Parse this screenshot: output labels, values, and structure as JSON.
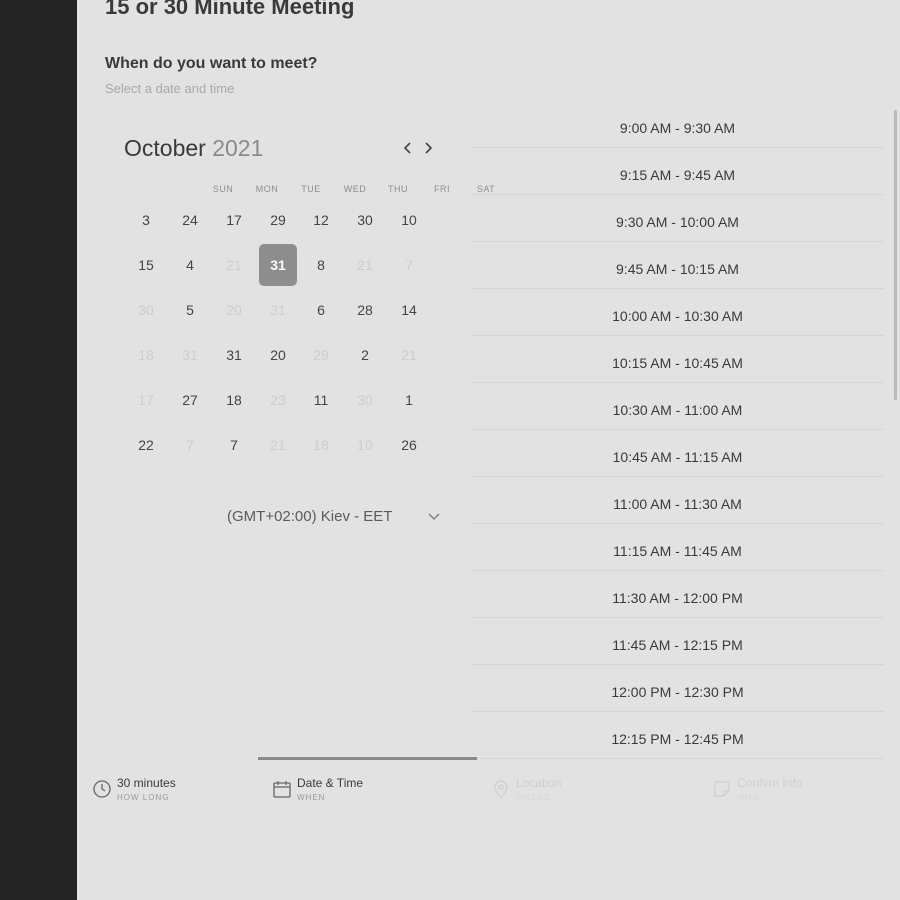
{
  "page": {
    "title": "15 or 30 Minute Meeting",
    "section_title": "When do you want to meet?",
    "section_subtitle": "Select a date and time"
  },
  "calendar": {
    "month": "October",
    "year": "2021",
    "weekdays": [
      "SUN",
      "MON",
      "TUE",
      "WED",
      "THU",
      "FRI",
      "SAT"
    ],
    "weeks": [
      [
        {
          "d": "3",
          "s": "n"
        },
        {
          "d": "24",
          "s": "n"
        },
        {
          "d": "17",
          "s": "n"
        },
        {
          "d": "29",
          "s": "n"
        },
        {
          "d": "12",
          "s": "n"
        },
        {
          "d": "30",
          "s": "n"
        },
        {
          "d": "10",
          "s": "n"
        }
      ],
      [
        {
          "d": "15",
          "s": "n"
        },
        {
          "d": "4",
          "s": "n"
        },
        {
          "d": "21",
          "s": "f"
        },
        {
          "d": "31",
          "s": "sel"
        },
        {
          "d": "8",
          "s": "n"
        },
        {
          "d": "21",
          "s": "f"
        },
        {
          "d": "7",
          "s": "f"
        }
      ],
      [
        {
          "d": "30",
          "s": "f"
        },
        {
          "d": "5",
          "s": "n"
        },
        {
          "d": "20",
          "s": "f"
        },
        {
          "d": "31",
          "s": "f"
        },
        {
          "d": "6",
          "s": "n"
        },
        {
          "d": "28",
          "s": "n"
        },
        {
          "d": "14",
          "s": "n"
        }
      ],
      [
        {
          "d": "18",
          "s": "f"
        },
        {
          "d": "31",
          "s": "f"
        },
        {
          "d": "31",
          "s": "n"
        },
        {
          "d": "20",
          "s": "n"
        },
        {
          "d": "29",
          "s": "f"
        },
        {
          "d": "2",
          "s": "n"
        },
        {
          "d": "21",
          "s": "f"
        }
      ],
      [
        {
          "d": "17",
          "s": "f"
        },
        {
          "d": "27",
          "s": "n"
        },
        {
          "d": "18",
          "s": "n"
        },
        {
          "d": "23",
          "s": "f"
        },
        {
          "d": "11",
          "s": "n"
        },
        {
          "d": "30",
          "s": "f"
        },
        {
          "d": "1",
          "s": "n"
        }
      ],
      [
        {
          "d": "22",
          "s": "n"
        },
        {
          "d": "7",
          "s": "f"
        },
        {
          "d": "7",
          "s": "n"
        },
        {
          "d": "21",
          "s": "f"
        },
        {
          "d": "18",
          "s": "f"
        },
        {
          "d": "10",
          "s": "f"
        },
        {
          "d": "26",
          "s": "n"
        }
      ]
    ],
    "prev_icon": "chevron-left-icon",
    "next_icon": "chevron-right-icon"
  },
  "timezone": {
    "label": "(GMT+02:00) Kiev - EET",
    "icon": "chevron-down-icon"
  },
  "time_slots": [
    "9:00 AM - 9:30 AM",
    "9:15 AM - 9:45 AM",
    "9:30 AM - 10:00 AM",
    "9:45 AM - 10:15 AM",
    "10:00 AM - 10:30 AM",
    "10:15 AM - 10:45 AM",
    "10:30 AM - 11:00 AM",
    "10:45 AM - 11:15 AM",
    "11:00 AM - 11:30 AM",
    "11:15 AM - 11:45 AM",
    "11:30 AM - 12:00 PM",
    "11:45 AM - 12:15 PM",
    "12:00 PM - 12:30 PM",
    "12:15 PM - 12:45 PM"
  ],
  "steps": [
    {
      "title": "30 minutes",
      "sub": "HOW LONG",
      "icon": "clock-icon",
      "state": "done"
    },
    {
      "title": "Date & Time",
      "sub": "WHEN",
      "icon": "calendar-icon",
      "state": "active"
    },
    {
      "title": "Location",
      "sub": "WHERE",
      "icon": "location-pin-icon",
      "state": "disabled"
    },
    {
      "title": "Confirm Info",
      "sub": "WHO",
      "icon": "note-icon",
      "state": "disabled"
    }
  ],
  "colors": {
    "background": "#e2e2e2",
    "left_rail": "#242424",
    "selected_day": "#8e8e8e",
    "active_step_bar": "#8a8a8a"
  }
}
